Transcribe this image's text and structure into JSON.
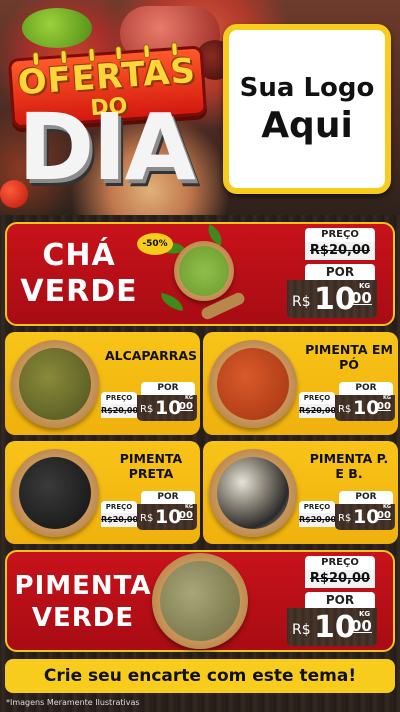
{
  "header": {
    "ofertas": "OFERTAS",
    "do": "DO",
    "dia": "DIA",
    "logo_line1": "Sua Logo",
    "logo_line2": "Aqui"
  },
  "colors": {
    "red": "#c8121a",
    "yellow": "#f8c418",
    "wood": "#2b221c"
  },
  "featured": {
    "name_line1": "CHÁ",
    "name_line2": "VERDE",
    "discount": "-50%",
    "preco_label": "PREÇO",
    "old_price": "R$20,00",
    "por_label": "POR",
    "currency": "R$",
    "new_int": "10",
    "new_dec": "00",
    "unit": "KG"
  },
  "products": [
    {
      "name": "ALCAPARRAS",
      "preco_label": "PREÇO",
      "por_label": "POR",
      "old_price": "R$20,00",
      "currency": "R$",
      "new_int": "10",
      "new_dec": "00",
      "unit": "KG"
    },
    {
      "name_line1": "PIMENTA EM",
      "name_line2": "PÓ",
      "preco_label": "PREÇO",
      "por_label": "POR",
      "old_price": "R$20,00",
      "currency": "R$",
      "new_int": "10",
      "new_dec": "00",
      "unit": "KG"
    },
    {
      "name_line1": "PIMENTA",
      "name_line2": "PRETA",
      "preco_label": "PREÇO",
      "por_label": "POR",
      "old_price": "R$20,00",
      "currency": "R$",
      "new_int": "10",
      "new_dec": "00",
      "unit": "KG"
    },
    {
      "name_line1": "PIMENTA P.",
      "name_line2": "E B.",
      "preco_label": "PREÇO",
      "por_label": "POR",
      "old_price": "R$20,00",
      "currency": "R$",
      "new_int": "10",
      "new_dec": "00",
      "unit": "KG"
    }
  ],
  "bottom_featured": {
    "name_line1": "PIMENTA",
    "name_line2": "VERDE",
    "preco_label": "PREÇO",
    "old_price": "R$20,00",
    "por_label": "POR",
    "currency": "R$",
    "new_int": "10",
    "new_dec": "00",
    "unit": "KG"
  },
  "footer": {
    "cta": "Crie seu encarte com este tema!",
    "disclaimer": "*Imagens Meramente Ilustrativas"
  }
}
